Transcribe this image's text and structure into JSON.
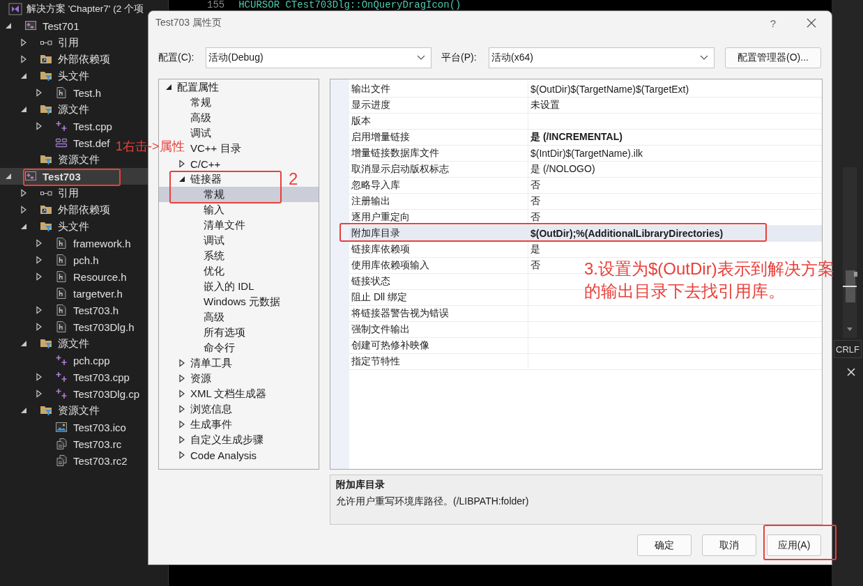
{
  "editor": {
    "line_number": "155",
    "code": "HCURSOR CTest703Dlg::OnQueryDragIcon()",
    "line_ending": "CRLF"
  },
  "solution_explorer": {
    "title": "解决方案 'Chapter7' (2 个项",
    "items": [
      {
        "label": "Test701",
        "kind": "project",
        "expanded": true,
        "bold": false,
        "selected": false,
        "children": [
          {
            "label": "引用",
            "kind": "references",
            "expanded": false,
            "selected": false
          },
          {
            "label": "外部依赖项",
            "kind": "external",
            "expanded": false,
            "selected": false
          },
          {
            "label": "头文件",
            "kind": "filter",
            "expanded": true,
            "selected": false,
            "children": [
              {
                "label": "Test.h",
                "kind": "header",
                "expanded": false,
                "selected": false
              }
            ]
          },
          {
            "label": "源文件",
            "kind": "filter",
            "expanded": true,
            "selected": false,
            "children": [
              {
                "label": "Test.cpp",
                "kind": "cpp",
                "expanded": false,
                "selected": false
              },
              {
                "label": "Test.def",
                "kind": "def",
                "selected": false
              }
            ]
          },
          {
            "label": "资源文件",
            "kind": "filter",
            "selected": false
          }
        ]
      },
      {
        "label": "Test703",
        "kind": "project",
        "expanded": true,
        "bold": true,
        "selected": true,
        "children": [
          {
            "label": "引用",
            "kind": "references",
            "expanded": false,
            "selected": false
          },
          {
            "label": "外部依赖项",
            "kind": "external",
            "expanded": false,
            "selected": false
          },
          {
            "label": "头文件",
            "kind": "filter",
            "expanded": true,
            "selected": false,
            "children": [
              {
                "label": "framework.h",
                "kind": "header",
                "expanded": false,
                "selected": false
              },
              {
                "label": "pch.h",
                "kind": "header",
                "expanded": false,
                "selected": false
              },
              {
                "label": "Resource.h",
                "kind": "header",
                "expanded": false,
                "selected": false
              },
              {
                "label": "targetver.h",
                "kind": "header",
                "selected": false
              },
              {
                "label": "Test703.h",
                "kind": "header",
                "expanded": false,
                "selected": false
              },
              {
                "label": "Test703Dlg.h",
                "kind": "header",
                "expanded": false,
                "selected": false
              }
            ]
          },
          {
            "label": "源文件",
            "kind": "filter",
            "expanded": true,
            "selected": false,
            "children": [
              {
                "label": "pch.cpp",
                "kind": "cpp",
                "selected": false
              },
              {
                "label": "Test703.cpp",
                "kind": "cpp",
                "expanded": false,
                "selected": false
              },
              {
                "label": "Test703Dlg.cp",
                "kind": "cpp",
                "expanded": false,
                "selected": false
              }
            ]
          },
          {
            "label": "资源文件",
            "kind": "filter",
            "expanded": true,
            "selected": false,
            "children": [
              {
                "label": "Test703.ico",
                "kind": "ico",
                "selected": false
              },
              {
                "label": "Test703.rc",
                "kind": "rc",
                "selected": false
              },
              {
                "label": "Test703.rc2",
                "kind": "rc",
                "selected": false
              }
            ]
          }
        ]
      }
    ]
  },
  "dialog": {
    "title": "Test703 属性页",
    "help": "?",
    "config_label": "配置(C):",
    "config_value": "活动(Debug)",
    "platform_label": "平台(P):",
    "platform_value": "活动(x64)",
    "manager_button": "配置管理器(O)...",
    "tree": [
      {
        "label": "配置属性",
        "expanded": true,
        "selected": false,
        "children": [
          {
            "label": "常规",
            "selected": false
          },
          {
            "label": "高级",
            "selected": false
          },
          {
            "label": "调试",
            "selected": false
          },
          {
            "label": "VC++ 目录",
            "selected": false
          },
          {
            "label": "C/C++",
            "expanded": false,
            "selected": false
          },
          {
            "label": "链接器",
            "expanded": true,
            "selected": false,
            "children": [
              {
                "label": "常规",
                "selected": true
              },
              {
                "label": "输入",
                "selected": false
              },
              {
                "label": "清单文件",
                "selected": false
              },
              {
                "label": "调试",
                "selected": false
              },
              {
                "label": "系统",
                "selected": false
              },
              {
                "label": "优化",
                "selected": false
              },
              {
                "label": "嵌入的 IDL",
                "selected": false
              },
              {
                "label": "Windows 元数据",
                "selected": false
              },
              {
                "label": "高级",
                "selected": false
              },
              {
                "label": "所有选项",
                "selected": false
              },
              {
                "label": "命令行",
                "selected": false
              }
            ]
          },
          {
            "label": "清单工具",
            "expanded": false,
            "selected": false
          },
          {
            "label": "资源",
            "expanded": false,
            "selected": false
          },
          {
            "label": "XML 文档生成器",
            "expanded": false,
            "selected": false
          },
          {
            "label": "浏览信息",
            "expanded": false,
            "selected": false
          },
          {
            "label": "生成事件",
            "expanded": false,
            "selected": false
          },
          {
            "label": "自定义生成步骤",
            "expanded": false,
            "selected": false
          },
          {
            "label": "Code Analysis",
            "expanded": false,
            "selected": false
          }
        ]
      }
    ],
    "properties": [
      {
        "name": "输出文件",
        "value": "$(OutDir)$(TargetName)$(TargetExt)",
        "bold": false,
        "selected": false
      },
      {
        "name": "显示进度",
        "value": "未设置",
        "bold": false,
        "selected": false
      },
      {
        "name": "版本",
        "selected": false
      },
      {
        "name": "启用增量链接",
        "value": "是 (/INCREMENTAL)",
        "bold": true,
        "selected": false
      },
      {
        "name": "增量链接数据库文件",
        "value": "$(IntDir)$(TargetName).ilk",
        "bold": false,
        "selected": false
      },
      {
        "name": "取消显示启动版权标志",
        "value": "是 (/NOLOGO)",
        "bold": false,
        "selected": false
      },
      {
        "name": "忽略导入库",
        "value": "否",
        "bold": false,
        "selected": false
      },
      {
        "name": "注册输出",
        "value": "否",
        "bold": false,
        "selected": false
      },
      {
        "name": "逐用户重定向",
        "value": "否",
        "bold": false,
        "selected": false
      },
      {
        "name": "附加库目录",
        "value": "$(OutDir);%(AdditionalLibraryDirectories)",
        "bold": true,
        "selected": true
      },
      {
        "name": "链接库依赖项",
        "value": "是",
        "bold": false,
        "selected": false
      },
      {
        "name": "使用库依赖项输入",
        "value": "否",
        "bold": false,
        "selected": false
      },
      {
        "name": "链接状态",
        "selected": false
      },
      {
        "name": "阻止 Dll 绑定",
        "selected": false
      },
      {
        "name": "将链接器警告视为错误",
        "selected": false
      },
      {
        "name": "强制文件输出",
        "selected": false
      },
      {
        "name": "创建可热修补映像",
        "selected": false
      },
      {
        "name": "指定节特性",
        "selected": false
      }
    ],
    "description": {
      "title": "附加库目录",
      "text": "允许用户重写环境库路径。(/LIBPATH:folder)"
    },
    "buttons": [
      {
        "label": "确定"
      },
      {
        "label": "取消"
      },
      {
        "label": "应用(A)"
      }
    ]
  },
  "annotations": [
    {
      "kind": "step",
      "text": "1右击->属性"
    },
    {
      "kind": "step",
      "text": "2"
    },
    {
      "kind": "step",
      "text": "3.设置为$(OutDir)表示到解决方案的输出目录下去找引用库。"
    }
  ]
}
